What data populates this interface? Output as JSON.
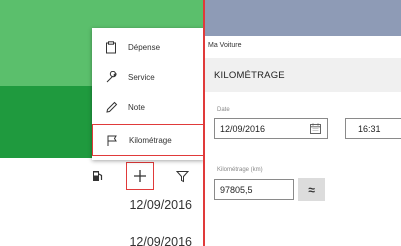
{
  "menu": {
    "items": [
      {
        "label": "Dépense",
        "icon": "clipboard-icon"
      },
      {
        "label": "Service",
        "icon": "wrench-icon"
      },
      {
        "label": "Note",
        "icon": "pencil-icon"
      },
      {
        "label": "Kilométrage",
        "icon": "flag-icon",
        "selected": true
      }
    ]
  },
  "list": {
    "dates": [
      "12/09/2016",
      "12/09/2016"
    ]
  },
  "form": {
    "app_title": "Ma Voiture",
    "page_title": "KILOMÉTRAGE",
    "date_label": "Date",
    "date_value": "12/09/2016",
    "time_value": "16:31",
    "km_label": "Kilométrage (km)",
    "km_value": "97805,5",
    "approx_label": "≈"
  },
  "colors": {
    "header_light": "#5bbf6c",
    "header_dark": "#1f9a3e",
    "highlight": "#e03a3a",
    "titlebar": "#8e9bb6"
  }
}
